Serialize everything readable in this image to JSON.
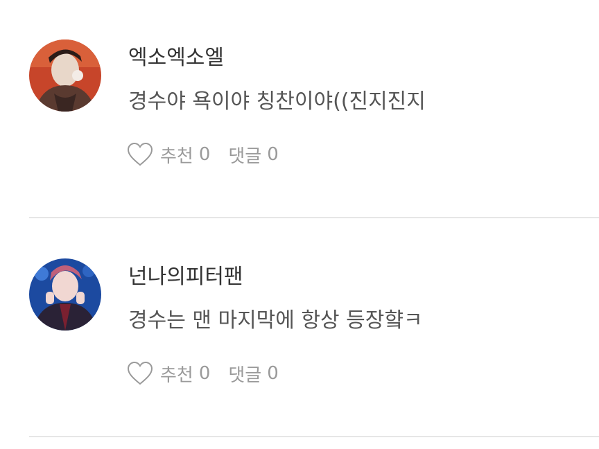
{
  "comments": [
    {
      "nickname": "엑소엑소엘",
      "text": "경수야 욕이야 칭찬이야((진지진지",
      "like_label": "추천",
      "like_count": "0",
      "reply_label": "댓글",
      "reply_count": "0",
      "avatar_colors": [
        "#c7452a",
        "#5a3a30",
        "#e8d7c9"
      ]
    },
    {
      "nickname": "넌나의피터팬",
      "text": "경수는 맨 마지막에 항상 등장햨ㅋ",
      "like_label": "추천",
      "like_count": "0",
      "reply_label": "댓글",
      "reply_count": "0",
      "avatar_colors": [
        "#1c4aa0",
        "#2a2236",
        "#f1d7d2"
      ]
    }
  ],
  "icons": {
    "like": "heart-outline-icon"
  },
  "colors": {
    "divider": "#e6e6e6",
    "muted_text": "#9a9a9a"
  }
}
